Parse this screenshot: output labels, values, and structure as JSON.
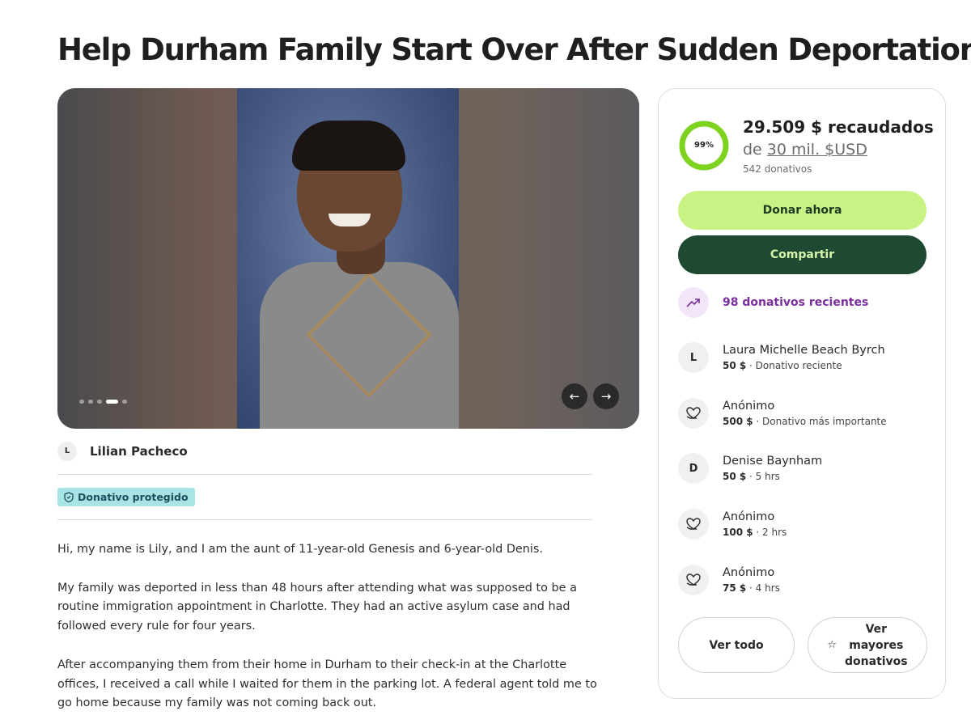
{
  "campaign": {
    "title": "Help Durham Family Start Over After Sudden Deportation"
  },
  "organizer": {
    "avatar_initial": "L",
    "name": "Lilian Pacheco"
  },
  "protection_badge": "Donativo protegido",
  "story": [
    "Hi, my name is Lily, and I am the aunt of 11-year-old Genesis and 6-year-old Denis.",
    "My family was deported in less than 48 hours after attending what was supposed to be a routine immigration appointment in Charlotte. They had an active asylum case and had followed every rule for four years.",
    "After accompanying them from their home in Durham to their check-in at the Charlotte offices, I received a call while I waited for them in the parking lot. A federal agent told me to go home because my family was not coming back out."
  ],
  "gallery": {
    "slide_count": 5,
    "active_slide": 4,
    "prev_icon": "arrow-left-icon",
    "next_icon": "arrow-right-icon"
  },
  "progress": {
    "percent_label": "99%",
    "fraction": 0.99,
    "raised_label": "29.509 $ recaudados",
    "goal_prefix": "de",
    "goal_amount": "30 mil. $USD",
    "donations_count": "542 donativos"
  },
  "actions": {
    "donate_label": "Donar ahora",
    "share_label": "Compartir"
  },
  "recent": {
    "label": "98 donativos recientes",
    "icon": "trending-up-icon"
  },
  "donors": [
    {
      "avatar": "L",
      "name": "Laura Michelle Beach Byrch",
      "amount": "50 $",
      "detail": " · Donativo reciente"
    },
    {
      "avatar": "heart-hand-icon",
      "name": "Anónimo",
      "amount": "500 $",
      "detail": " · Donativo más importante"
    },
    {
      "avatar": "D",
      "name": "Denise Baynham",
      "amount": "50 $",
      "detail": " · 5 hrs"
    },
    {
      "avatar": "heart-hand-icon",
      "name": "Anónimo",
      "amount": "100 $",
      "detail": " · 2 hrs"
    },
    {
      "avatar": "heart-hand-icon",
      "name": "Anónimo",
      "amount": "75 $",
      "detail": " · 4 hrs"
    }
  ],
  "footer_buttons": {
    "see_all": "Ver todo",
    "top_line1": "Ver",
    "top_line2": "mayores",
    "top_line3": "donativos",
    "top_icon": "star-icon"
  },
  "colors": {
    "donate_bg": "#c9f285",
    "share_bg": "#1e4a33",
    "progress": "#7ed321",
    "recent_accent": "#7b2f9e",
    "badge_bg": "#a9e4e4"
  }
}
